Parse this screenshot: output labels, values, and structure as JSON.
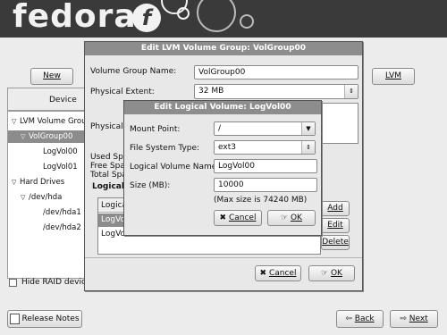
{
  "brand": {
    "logo_text": "fedora",
    "logo_mark": "f"
  },
  "toolbar": {
    "new_label": "New",
    "lvm_label": "LVM"
  },
  "device_column_header": "Device",
  "tree": {
    "rows": [
      {
        "label": "LVM Volume Group",
        "level": 0,
        "expand": "▽"
      },
      {
        "label": "VolGroup00",
        "level": 1,
        "expand": "▽"
      },
      {
        "label": "LogVol00",
        "level": 2,
        "expand": ""
      },
      {
        "label": "LogVol01",
        "level": 2,
        "expand": ""
      },
      {
        "label": "Hard Drives",
        "level": 0,
        "expand": "▽"
      },
      {
        "label": "/dev/hda",
        "level": 1,
        "expand": "▽"
      },
      {
        "label": "/dev/hda1",
        "level": 2,
        "expand": ""
      },
      {
        "label": "/dev/hda2",
        "level": 2,
        "expand": ""
      }
    ],
    "selected_index": 1
  },
  "hide_raid": {
    "label": "Hide RAID device",
    "checked": false
  },
  "footer": {
    "release_notes_label": "Release Notes",
    "back_label": "Back",
    "next_label": "Next"
  },
  "vg_dialog": {
    "title": "Edit LVM Volume Group: VolGroup00",
    "vg_name_label": "Volume Group Name:",
    "vg_name_value": "VolGroup00",
    "pe_label": "Physical Extent:",
    "pe_value": "32 MB",
    "pv_label": "Physical V",
    "used_space_label": "Used Spa",
    "free_space_label": "Free Spac",
    "total_space_label": "Total Spa",
    "logical_label": "Logical",
    "lv_list_header": "Logica",
    "lv_list_rows": [
      "LogVo",
      "LogVo"
    ],
    "add_label": "Add",
    "edit_label": "Edit",
    "delete_label": "Delete",
    "cancel_label": "Cancel",
    "ok_label": "OK"
  },
  "lv_dialog": {
    "title": "Edit Logical Volume: LogVol00",
    "mount_label": "Mount Point:",
    "mount_value": "/",
    "fs_label": "File System Type:",
    "fs_value": "ext3",
    "lv_name_label": "Logical Volume Name:",
    "lv_name_value": "LogVol00",
    "size_label": "Size (MB):",
    "size_value": "10000",
    "max_size_note": "(Max size is 74240 MB)",
    "cancel_label": "Cancel",
    "ok_label": "OK"
  }
}
